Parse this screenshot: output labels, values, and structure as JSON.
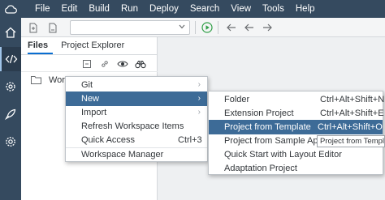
{
  "menubar": {
    "items": [
      "File",
      "Edit",
      "Build",
      "Run",
      "Deploy",
      "Search",
      "View",
      "Tools",
      "Help"
    ]
  },
  "icons": {
    "cloud": "cloud-icon",
    "rail": [
      "home-icon",
      "code-icon",
      "gear-cluster-icon",
      "rocket-icon",
      "settings-icon"
    ]
  },
  "panel": {
    "tabs": [
      "Files",
      "Project Explorer"
    ],
    "tree_root_label": "Work"
  },
  "context_menu": {
    "items": [
      {
        "label": "Git",
        "shortcut": "",
        "submenu": true
      },
      {
        "label": "New",
        "shortcut": "",
        "submenu": true
      },
      {
        "label": "Import",
        "shortcut": "",
        "submenu": true
      },
      {
        "label": "Refresh Workspace Items",
        "shortcut": "",
        "submenu": false
      },
      {
        "label": "Quick Access",
        "shortcut": "Ctrl+3",
        "submenu": false
      },
      {
        "label": "Workspace Manager",
        "shortcut": "",
        "submenu": false
      }
    ],
    "highlighted": "New"
  },
  "submenu": {
    "items": [
      {
        "label": "Folder",
        "shortcut": "Ctrl+Alt+Shift+N"
      },
      {
        "label": "Extension Project",
        "shortcut": "Ctrl+Alt+Shift+E"
      },
      {
        "label": "Project from Template",
        "shortcut": "Ctrl+Alt+Shift+O"
      },
      {
        "label": "Project from Sample Appli",
        "shortcut": ""
      },
      {
        "label": "Quick Start with Layout Editor",
        "shortcut": ""
      },
      {
        "label": "Adaptation Project",
        "shortcut": ""
      }
    ],
    "highlighted": "Project from Template"
  },
  "tooltip": {
    "text": "Project from Template"
  },
  "colors": {
    "shell": "#354a5f",
    "highlight": "#3d6b97",
    "run": "#2e9e45"
  }
}
